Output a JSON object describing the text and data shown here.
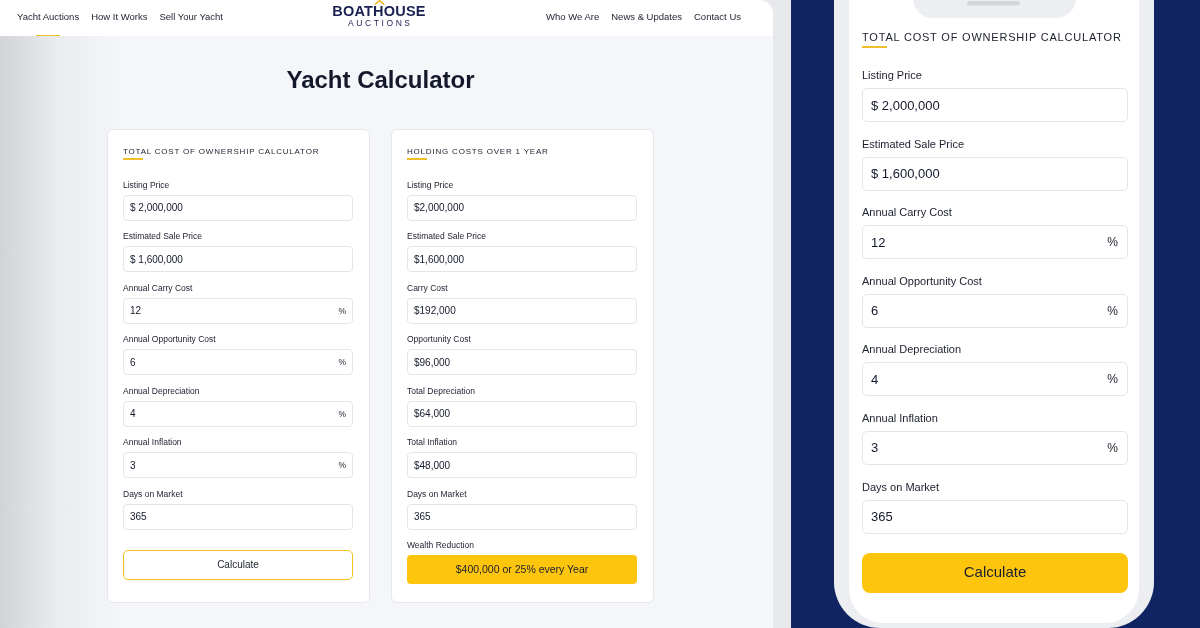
{
  "nav": {
    "left_links": [
      {
        "label": "Yacht Auctions",
        "selected": true
      },
      {
        "label": "How It Works",
        "selected": false
      },
      {
        "label": "Sell Your Yacht",
        "selected": false
      }
    ],
    "logo": {
      "wordmark": "BOATHOUSE",
      "subtitle": "AUCTIONS"
    },
    "right_links": [
      {
        "label": "Who We Are",
        "selected": false
      },
      {
        "label": "News & Updates",
        "selected": false
      },
      {
        "label": "Contact Us",
        "selected": false
      }
    ]
  },
  "page_title": "Yacht Calculator",
  "ownership_calculator": {
    "title": "TOTAL COST OF OWNERSHIP CALCULATOR",
    "fields": [
      {
        "label": "Listing Price",
        "value": "$ 2,000,000"
      },
      {
        "label": "Estimated Sale Price",
        "value": "$ 1,600,000"
      },
      {
        "label": "Annual Carry Cost",
        "value": "12",
        "suffix": "%"
      },
      {
        "label": "Annual Opportunity Cost",
        "value": "6",
        "suffix": "%"
      },
      {
        "label": "Annual Depreciation",
        "value": "4",
        "suffix": "%"
      },
      {
        "label": "Annual Inflation",
        "value": "3",
        "suffix": "%"
      },
      {
        "label": "Days on Market",
        "value": "365"
      }
    ],
    "button": {
      "label": "Calculate",
      "kind": "outline"
    }
  },
  "holding_costs": {
    "title": "HOLDING COSTS OVER 1 YEAR",
    "fields": [
      {
        "label": "Listing Price",
        "value": "$2,000,000"
      },
      {
        "label": "Estimated Sale Price",
        "value": "$1,600,000"
      },
      {
        "label": "Carry Cost",
        "value": "$192,000"
      },
      {
        "label": "Opportunity Cost",
        "value": "$96,000"
      },
      {
        "label": "Total Depreciation",
        "value": "$64,000"
      },
      {
        "label": "Total Inflation",
        "value": "$48,000"
      },
      {
        "label": "Days on Market",
        "value": "365"
      }
    ],
    "result": {
      "label": "Wealth Reduction",
      "value": "$400,000 or 25% every Year"
    }
  },
  "phone_calculator": {
    "title": "TOTAL COST OF OWNERSHIP CALCULATOR",
    "fields": [
      {
        "label": "Listing Price",
        "value": "$ 2,000,000"
      },
      {
        "label": "Estimated Sale Price",
        "value": "$ 1,600,000"
      },
      {
        "label": "Annual Carry Cost",
        "value": "12",
        "suffix": "%"
      },
      {
        "label": "Annual Opportunity Cost",
        "value": "6",
        "suffix": "%"
      },
      {
        "label": "Annual Depreciation",
        "value": "4",
        "suffix": "%"
      },
      {
        "label": "Annual Inflation",
        "value": "3",
        "suffix": "%"
      },
      {
        "label": "Days on Market",
        "value": "365"
      }
    ],
    "button": {
      "label": "Calculate",
      "kind": "filled"
    }
  }
}
